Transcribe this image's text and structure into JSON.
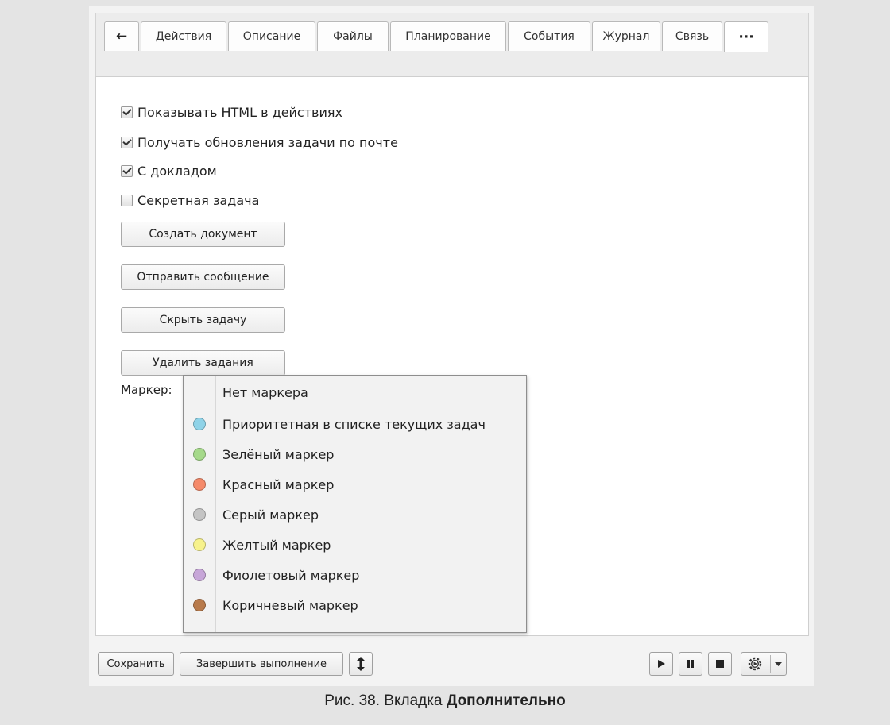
{
  "tabs": [
    {
      "label": "←",
      "kind": "back"
    },
    {
      "label": "Действия"
    },
    {
      "label": "Описание"
    },
    {
      "label": "Файлы"
    },
    {
      "label": "Планирование"
    },
    {
      "label": "События"
    },
    {
      "label": "Журнал"
    },
    {
      "label": "Связь"
    },
    {
      "label": "···",
      "kind": "more",
      "active": true
    }
  ],
  "options": [
    {
      "label": "Показывать HTML в действиях",
      "checked": true
    },
    {
      "label": "Получать обновления задачи по почте",
      "checked": true
    },
    {
      "label": "С докладом",
      "checked": true
    },
    {
      "label": "Секретная задача",
      "checked": false
    }
  ],
  "actions": {
    "create_document": "Создать документ",
    "send_message": "Отправить сообщение",
    "hide_task": "Скрыть задачу",
    "delete_tasks": "Удалить задания"
  },
  "marker": {
    "label": "Маркер:",
    "options": [
      {
        "label": "Нет маркера",
        "color": null
      },
      {
        "label": "Приоритетная в списке текущих задач",
        "color": "#8fd3e8"
      },
      {
        "label": "Зелёный маркер",
        "color": "#a5d98a"
      },
      {
        "label": "Красный маркер",
        "color": "#f58a6a"
      },
      {
        "label": "Серый маркер",
        "color": "#c4c4c4"
      },
      {
        "label": "Желтый маркер",
        "color": "#f7f28c"
      },
      {
        "label": "Фиолетовый маркер",
        "color": "#c7a6d8"
      },
      {
        "label": "Коричневый маркер",
        "color": "#b87a4b"
      }
    ]
  },
  "footer": {
    "save": "Сохранить",
    "complete": "Завершить выполнение",
    "resize_icon": "vertical-resize-icon",
    "play_icon": "play-icon",
    "pause_icon": "pause-icon",
    "stop_icon": "stop-icon",
    "settings_icon": "gear-play-icon",
    "dropdown_icon": "chevron-down-icon"
  },
  "caption": {
    "prefix": "Рис. 38. Вкладка ",
    "bold": "Дополнительно"
  }
}
